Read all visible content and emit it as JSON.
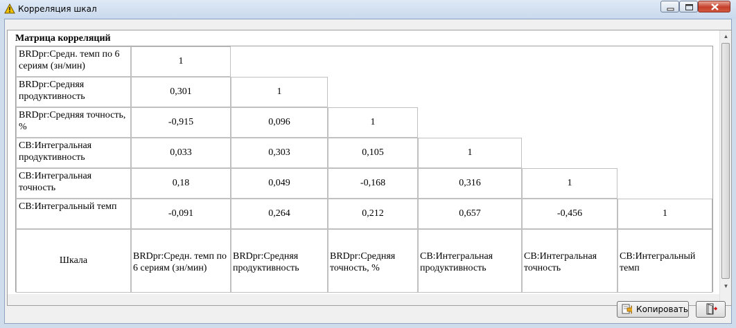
{
  "window": {
    "title": "Корреляция шкал",
    "icons": {
      "app": "warning-triangle-icon",
      "minimize": "minimize-icon",
      "maximize": "maximize-icon",
      "close": "close-icon"
    }
  },
  "matrix": {
    "title": "Матрица корреляций",
    "corner_label": "Шкала",
    "row_labels": [
      "BRDpr:Средн. темп по 6 сериям (зн/мин)",
      "BRDpr:Средняя продуктивность",
      "BRDpr:Средняя точность, %",
      "CB:Интегральная продуктивность",
      "CB:Интегральная точность",
      "CB:Интегральный темп"
    ],
    "column_labels": [
      "BRDpr:Средн. темп по 6 сериям (зн/мин)",
      "BRDpr:Средняя продуктивность",
      "BRDpr:Средняя точность, %",
      "CB:Интегральная продуктивность",
      "CB:Интегральная точность",
      "CB:Интегральный темп"
    ],
    "values": [
      [
        "1"
      ],
      [
        "0,301",
        "1"
      ],
      [
        "-0,915",
        "0,096",
        "1"
      ],
      [
        "0,033",
        "0,303",
        "0,105",
        "1"
      ],
      [
        "0,18",
        "0,049",
        "-0,168",
        "0,316",
        "1"
      ],
      [
        "-0,091",
        "0,264",
        "0,212",
        "0,657",
        "-0,456",
        "1"
      ]
    ]
  },
  "buttons": {
    "copy_label": "Копировать",
    "copy_icon": "copy-arrow-icon",
    "exit_icon": "exit-door-icon"
  }
}
